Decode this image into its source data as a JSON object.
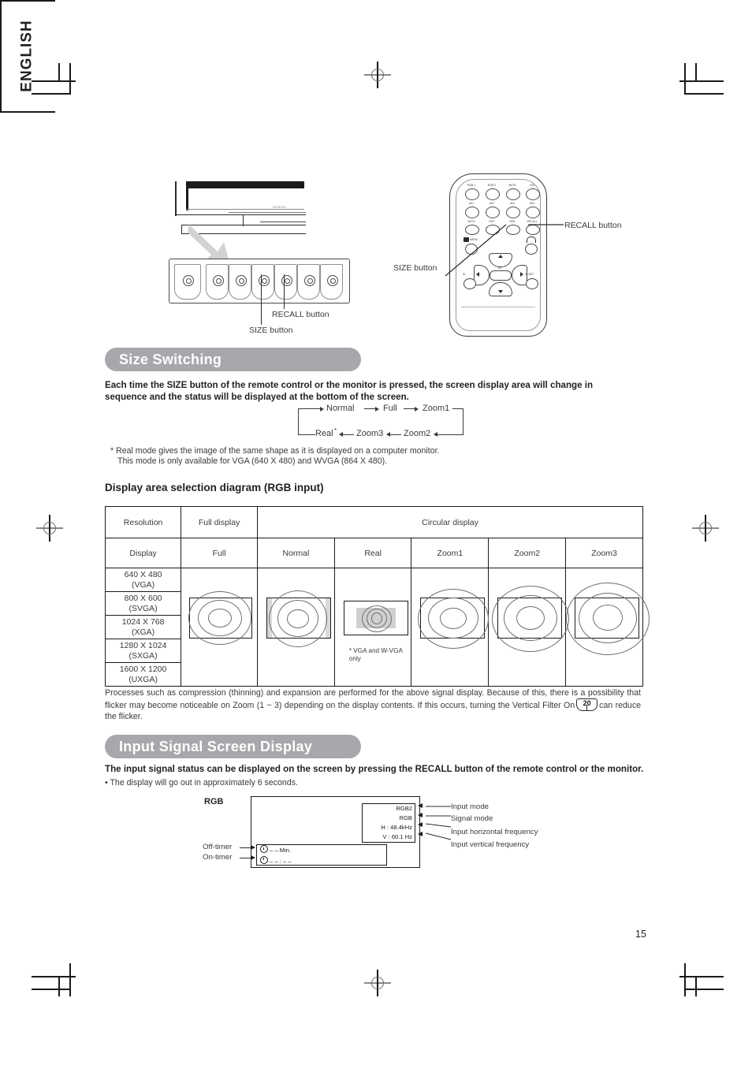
{
  "page": {
    "number": "15",
    "language_tab": "ENGLISH"
  },
  "top_illustration": {
    "monitor_callouts": [
      {
        "label": "RECALL button"
      },
      {
        "label": "SIZE button"
      }
    ],
    "remote_callouts": [
      {
        "label": "RECALL button"
      },
      {
        "label": "SIZE button"
      }
    ],
    "remote_buttons": [
      "RGB 1",
      "RGB 2",
      "MUTE",
      "VOL",
      "AV1",
      "AV2",
      "AV3",
      "AV4",
      "AUTO",
      "PinP",
      "SIZE",
      "RECALL",
      "MENU",
      "OK",
      "ID",
      "ID SET"
    ]
  },
  "size_switching": {
    "title": "Size Switching",
    "intro": "Each time the SIZE button of the remote control or the monitor is pressed, the screen display area will change in sequence and the status will be displayed at the bottom of the screen.",
    "flow_top": [
      "Normal",
      "Full",
      "Zoom1"
    ],
    "flow_bottom": [
      "Real",
      "Zoom3",
      "Zoom2"
    ],
    "real_asterisk": "*",
    "footnote_line1": "* Real mode gives the image of the same shape as it is displayed on a computer monitor.",
    "footnote_line2": "This mode is only available for VGA (640 X 480) and WVGA (864 X 480)."
  },
  "diagram": {
    "heading": "Display area selection diagram (RGB input)",
    "header_row1": {
      "resolution": "Resolution",
      "full_display": "Full display",
      "circular_display": "Circular display"
    },
    "header_row2": [
      "Display",
      "Full",
      "Normal",
      "Real",
      "Zoom1",
      "Zoom2",
      "Zoom3"
    ],
    "resolutions": [
      {
        "res": "640 X 480",
        "name": "(VGA)"
      },
      {
        "res": "800 X 600",
        "name": "(SVGA)"
      },
      {
        "res": "1024 X 768",
        "name": "(XGA)"
      },
      {
        "res": "1280 X 1024",
        "name": "(SXGA)"
      },
      {
        "res": "1600 X 1200",
        "name": "(UXGA)"
      }
    ],
    "real_note_line1": "* VGA and W-VGA",
    "real_note_line2": "only",
    "note_part1": "Processes such as compression (thinning) and expansion are performed for the above signal display. Because of this, there is a possibility that flicker may become noticeable on Zoom (1 ~ 3) depending on the display contents. If this occurs, turning the Vertical Filter On",
    "note_page_ref": "20",
    "note_part2": "can reduce the flicker."
  },
  "input_signal": {
    "title": "Input Signal Screen Display",
    "intro": "The input signal status can be displayed on the screen by pressing the RECALL button of the remote control or the monitor.",
    "bullet": "• The display will go out in approximately 6 seconds.",
    "osd_label": "RGB",
    "osd": {
      "input_mode": "RGB2",
      "signal_mode": "RGB",
      "h_freq": "H :  48.4kHz",
      "v_freq": "V :  60.1 Hz",
      "off_timer_value": "– – Min.",
      "on_timer_value": "– – : – –"
    },
    "callouts_right": [
      "Input mode",
      "Signal mode",
      "Input horizontal frequency",
      "Input vertical frequency"
    ],
    "callouts_left": [
      "Off-timer",
      "On-timer"
    ]
  },
  "colors": {
    "section_bar": "#a6a8ab",
    "ink": "#231f20",
    "grey_text": "#3a3a3a"
  }
}
